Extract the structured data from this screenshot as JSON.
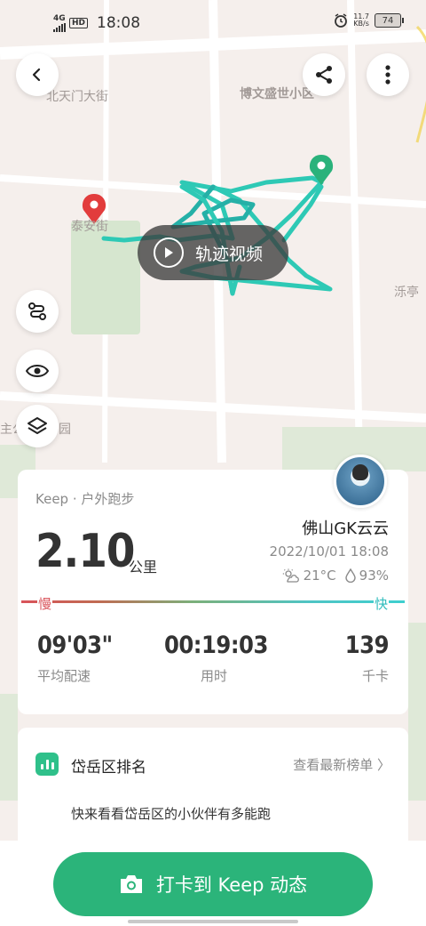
{
  "status_bar": {
    "network": "4G",
    "hd": "HD",
    "time": "18:08",
    "speed_value": "11.7",
    "speed_unit": "KB/s",
    "battery": "74"
  },
  "map": {
    "labels": [
      "北天门大街",
      "博文盛世小区",
      "泰安街",
      "泺亭",
      "主公",
      "园"
    ],
    "route_color": "#2ec9b5",
    "start_color": "#e23c3c",
    "end_color": "#2ab27b"
  },
  "buttons": {
    "video_label": "轨迹视频"
  },
  "workout": {
    "source": "Keep · 户外跑步",
    "distance": "2.10",
    "distance_unit": "公里",
    "user_name": "佛山GK云云",
    "datetime": "2022/10/01 18:08",
    "temperature": "21°C",
    "humidity": "93%",
    "slow_label": "慢",
    "fast_label": "快",
    "stats": [
      {
        "value": "09'03\"",
        "label": "平均配速"
      },
      {
        "value": "00:19:03",
        "label": "用时"
      },
      {
        "value": "139",
        "label": "千卡"
      }
    ]
  },
  "ranking": {
    "title": "岱岳区排名",
    "link": "查看最新榜单 〉",
    "desc": "快来看看岱岳区的小伙伴有多能跑"
  },
  "checkin": {
    "label": "打卡到 Keep 动态"
  },
  "colors": {
    "accent_green": "#2bb47a",
    "slow_red": "#d9535a",
    "fast_cyan": "#2fbcbc"
  }
}
